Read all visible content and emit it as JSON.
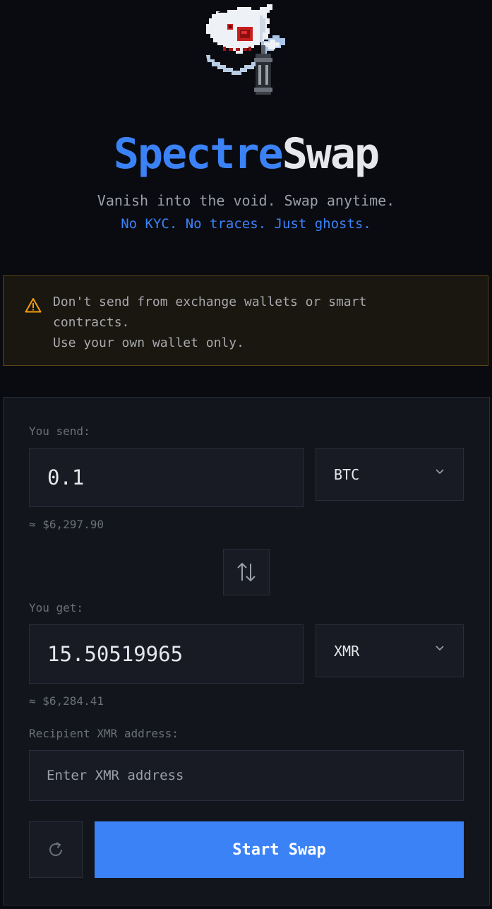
{
  "header": {
    "logo_icon": "ghost-lantern-pixel-icon",
    "title_part_a": "Spectre",
    "title_part_b": "Swap",
    "tagline": "Vanish into the void. Swap anytime.",
    "subtagline": "No KYC. No traces. Just ghosts."
  },
  "warning": {
    "icon": "warning-triangle-icon",
    "line1": "Don't send from exchange wallets or smart",
    "line2": "contracts.",
    "line3": "Use your own wallet only."
  },
  "swap": {
    "send_label": "You send:",
    "send_amount": "0.1",
    "send_currency": "BTC",
    "send_usd": "≈ $6,297.90",
    "get_label": "You get:",
    "get_amount": "15.50519965",
    "get_currency": "XMR",
    "get_usd": "≈ $6,284.41",
    "recipient_label": "Recipient XMR address:",
    "recipient_placeholder": "Enter XMR address",
    "recipient_value": "",
    "start_label": "Start Swap"
  },
  "colors": {
    "accent": "#3b82f6",
    "background": "#0a0b10",
    "panel": "#13151d",
    "warning_border": "#5a4515",
    "warning_icon": "#f59e0b"
  }
}
